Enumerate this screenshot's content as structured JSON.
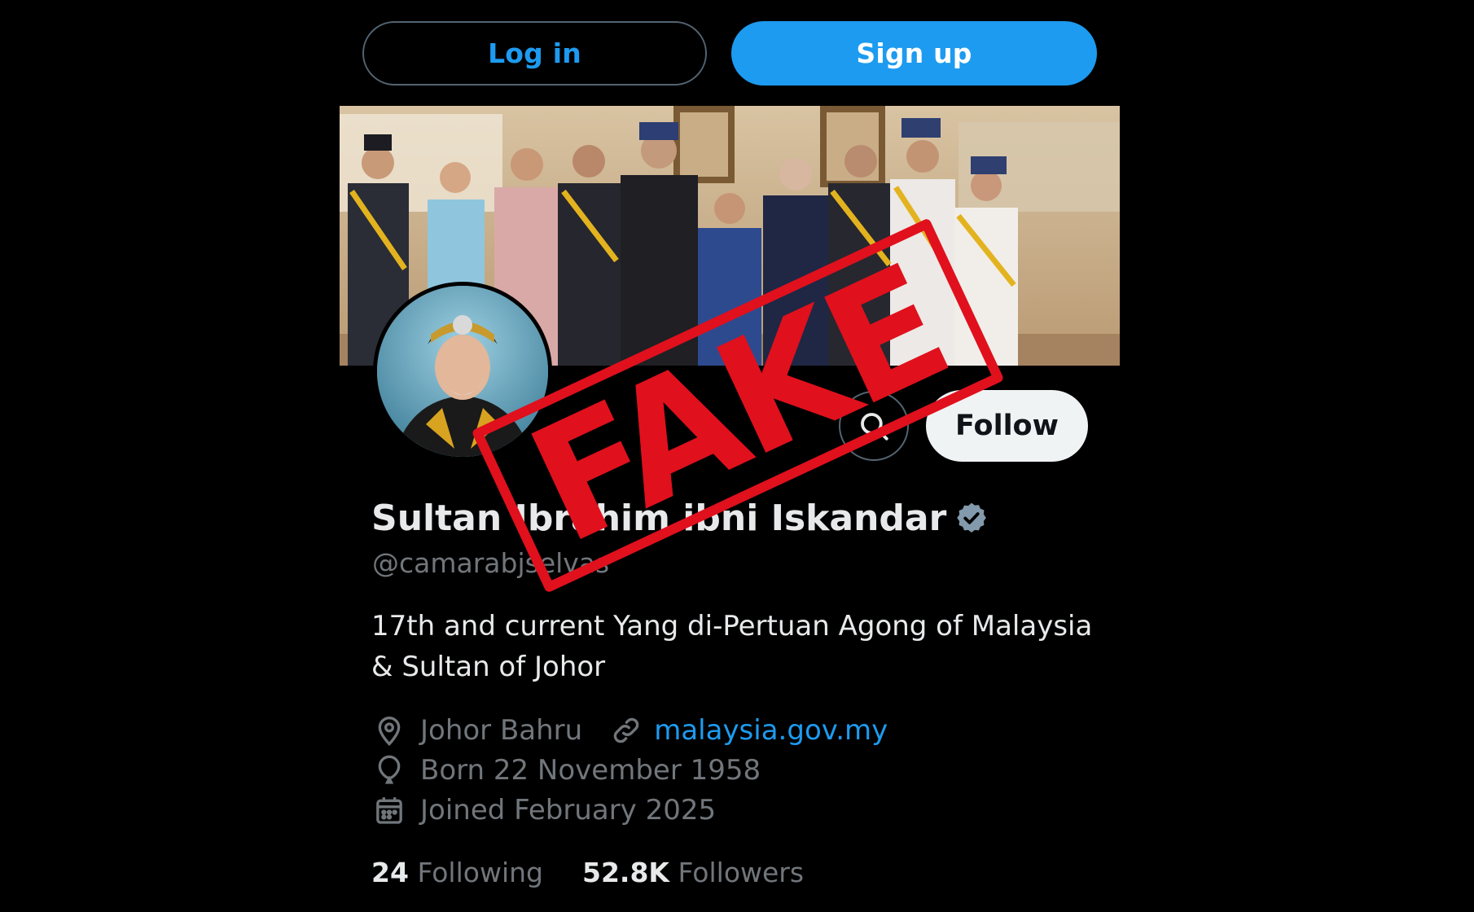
{
  "auth": {
    "login_label": "Log in",
    "signup_label": "Sign up"
  },
  "profile": {
    "display_name": "Sultan Ibrahim ibni Iskandar",
    "verified": true,
    "handle": "@camarabjselvas",
    "bio": "17th and current Yang di-Pertuan Agong of Malaysia & Sultan of Johor",
    "location": "Johor Bahru",
    "website": "malaysia.gov.my",
    "birthdate": "Born 22 November 1958",
    "joined": "Joined February 2025",
    "follow_label": "Follow",
    "stats": {
      "following_count": "24",
      "following_label": "Following",
      "followers_count": "52.8K",
      "followers_label": "Followers"
    }
  },
  "overlay": {
    "stamp_text": "FAKE"
  },
  "icons": {
    "search": "search-icon",
    "verified": "verified-badge-icon",
    "location": "location-pin-icon",
    "link": "link-icon",
    "birthday": "balloon-icon",
    "calendar": "calendar-icon"
  },
  "colors": {
    "accent": "#1d9bf0",
    "background": "#000000",
    "stamp": "#e0101d",
    "muted_text": "#71767b"
  }
}
